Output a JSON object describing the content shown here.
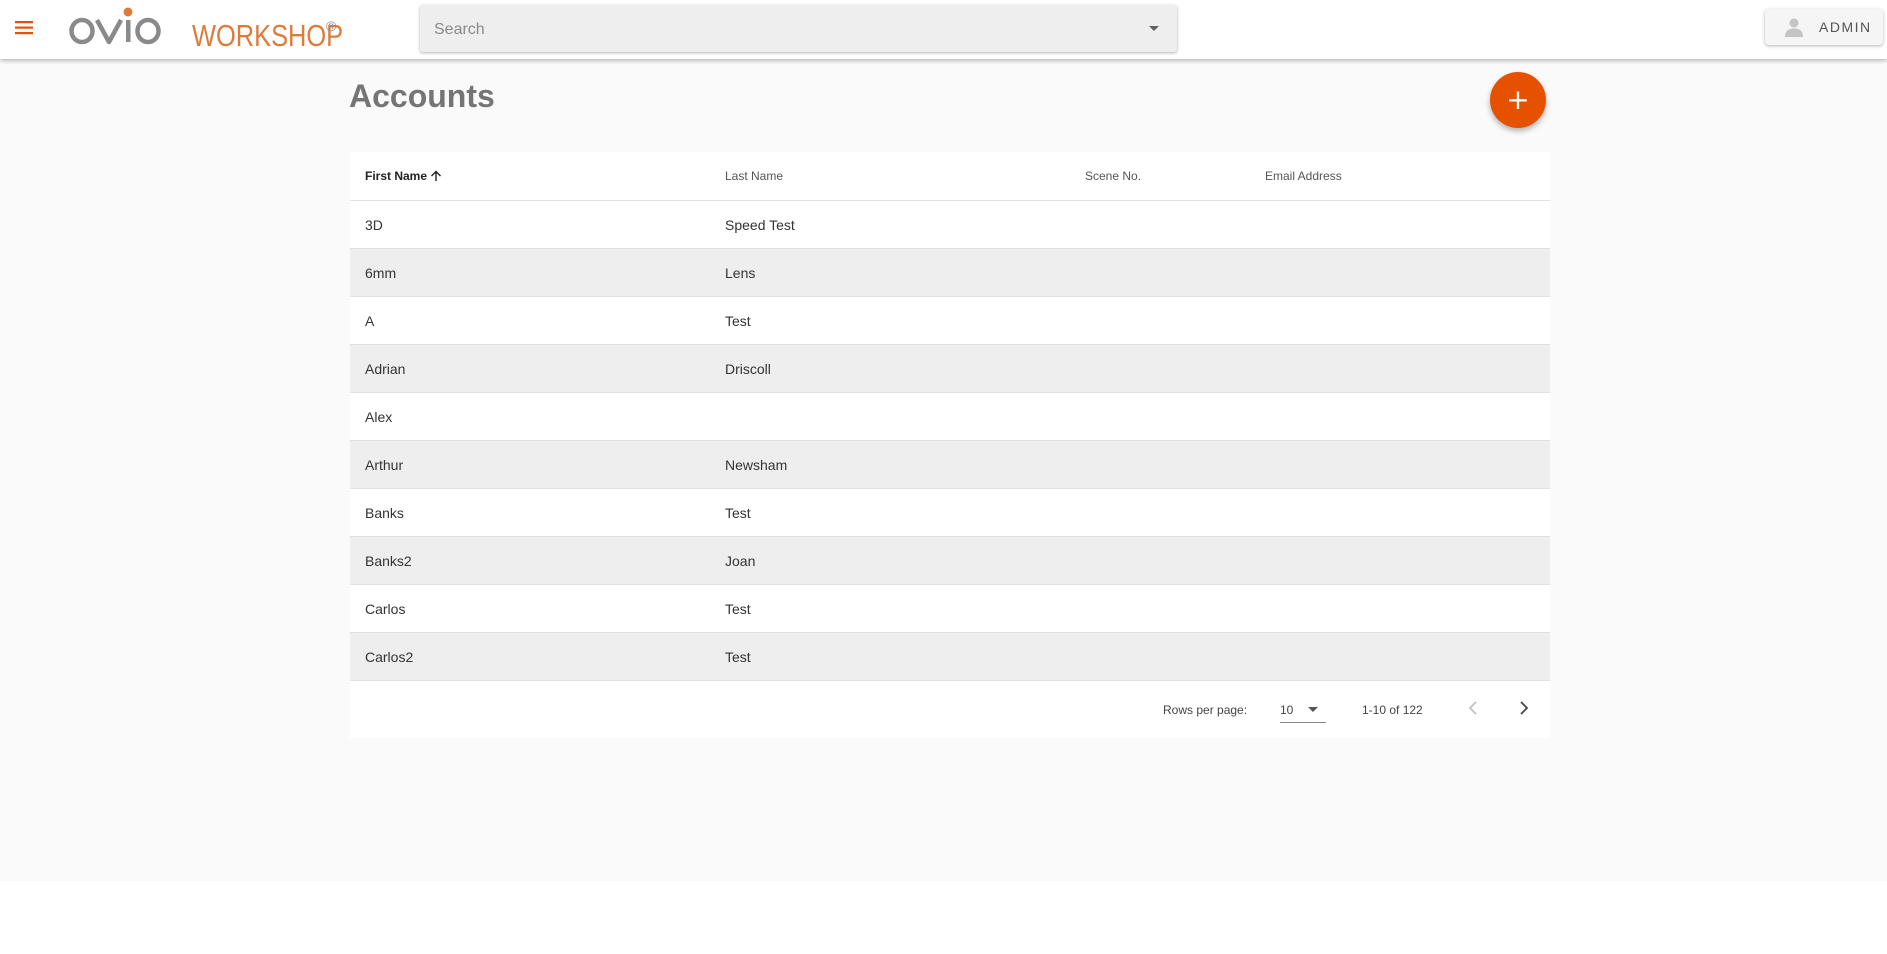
{
  "header": {
    "brand_word": "WORKSHOP",
    "brand_reg": "®",
    "search_placeholder": "Search",
    "user_label": "ADMIN"
  },
  "page": {
    "title": "Accounts",
    "add_button": "+"
  },
  "table": {
    "columns": [
      {
        "label": "First Name",
        "sorted": "ascending"
      },
      {
        "label": "Last Name"
      },
      {
        "label": "Scene No."
      },
      {
        "label": "Email Address"
      }
    ],
    "rows": [
      {
        "first": "3D",
        "last": "Speed Test",
        "scene": "",
        "email": ""
      },
      {
        "first": "6mm",
        "last": "Lens",
        "scene": "",
        "email": ""
      },
      {
        "first": "A",
        "last": "Test",
        "scene": "",
        "email": ""
      },
      {
        "first": "Adrian",
        "last": "Driscoll",
        "scene": "",
        "email": ""
      },
      {
        "first": "Alex",
        "last": "",
        "scene": "",
        "email": ""
      },
      {
        "first": "Arthur",
        "last": "Newsham",
        "scene": "",
        "email": ""
      },
      {
        "first": "Banks",
        "last": "Test",
        "scene": "",
        "email": ""
      },
      {
        "first": "Banks2",
        "last": "Joan",
        "scene": "",
        "email": ""
      },
      {
        "first": "Carlos",
        "last": "Test",
        "scene": "",
        "email": ""
      },
      {
        "first": "Carlos2",
        "last": "Test",
        "scene": "",
        "email": ""
      }
    ]
  },
  "pagination": {
    "rows_per_page_label": "Rows per page:",
    "rows_per_page": "10",
    "range": "1-10 of 122"
  },
  "colors": {
    "accent": "#e65100",
    "logo_gray": "#8a8a8a",
    "logo_orange": "#e07a3a",
    "row_alt": "#eeeeee",
    "title": "#757575"
  },
  "icons": {
    "menu": "menu-icon",
    "search_dropdown": "caret-down-icon",
    "user": "person-icon",
    "sort": "arrow-up-icon",
    "prev": "chevron-left-icon",
    "next": "chevron-right-icon"
  }
}
